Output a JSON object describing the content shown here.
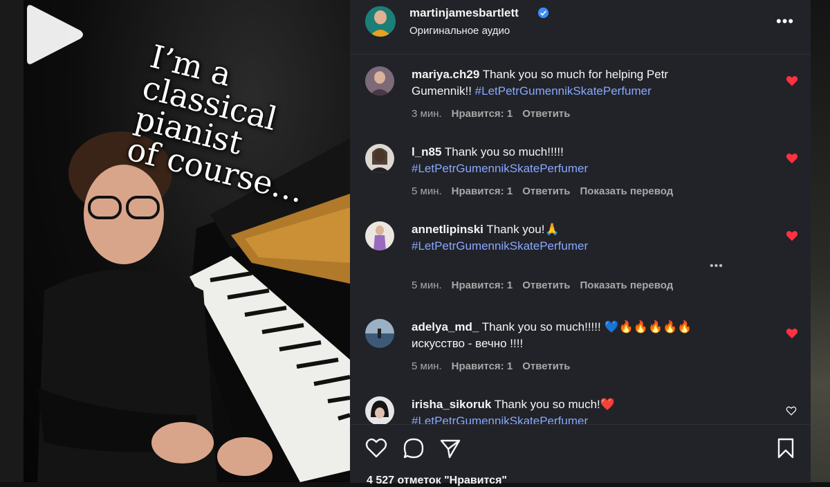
{
  "video": {
    "overlay_lines": [
      "I’m a",
      "classical",
      "pianist",
      "of course…"
    ]
  },
  "header": {
    "username": "martinjamesbartlett",
    "audio": "Оригинальное аудио",
    "more": "•••"
  },
  "comments": [
    {
      "username": "mariya.ch29",
      "text": " Thank you so much for helping Petr Gumennik!! ",
      "hashtag": "#LetPetrGumennikSkatePerfumer",
      "time": "3 мин.",
      "likes": "Нравится: 1",
      "reply": "Ответить",
      "translate": "",
      "liked": true,
      "avatar_color": "#8a6a7a"
    },
    {
      "username": "l_n85",
      "text": " Thank you so much!!!!! ",
      "hashtag": "#LetPetrGumennikSkatePerfumer",
      "time": "5 мин.",
      "likes": "Нравится: 1",
      "reply": "Ответить",
      "translate": "Показать перевод",
      "liked": true,
      "avatar_color": "#6a5a4a"
    },
    {
      "username": "annetlipinski",
      "text": " Thank you!🙏 ",
      "hashtag": "#LetPetrGumennikSkatePerfumer",
      "time": "5 мин.",
      "likes": "Нравится: 1",
      "reply": "Ответить",
      "translate": "Показать перевод",
      "liked": true,
      "avatar_color": "#b9a6c9"
    },
    {
      "username": "adelya_md_",
      "text": " Thank you so much!!!!! 💙🔥🔥🔥🔥🔥 искусство - вечно !!!!",
      "hashtag": "",
      "time": "5 мин.",
      "likes": "Нравится: 1",
      "reply": "Ответить",
      "translate": "",
      "liked": true,
      "avatar_color": "#4a6a8a"
    },
    {
      "username": "irisha_sikoruk",
      "text": " Thank you so much!❤️ ",
      "hashtag": "#LetPetrGumennikSkatePerfumer",
      "time": "",
      "likes": "",
      "reply": "",
      "translate": "",
      "liked": false,
      "avatar_color": "#d9d9d9"
    }
  ],
  "likes_summary": "4 527 отметок \"Нравится\"",
  "colors": {
    "accent_heart": "#ff3040",
    "hashtag": "#8aa8ff",
    "panel_bg": "#212328",
    "verified": "#3b8cf5"
  }
}
